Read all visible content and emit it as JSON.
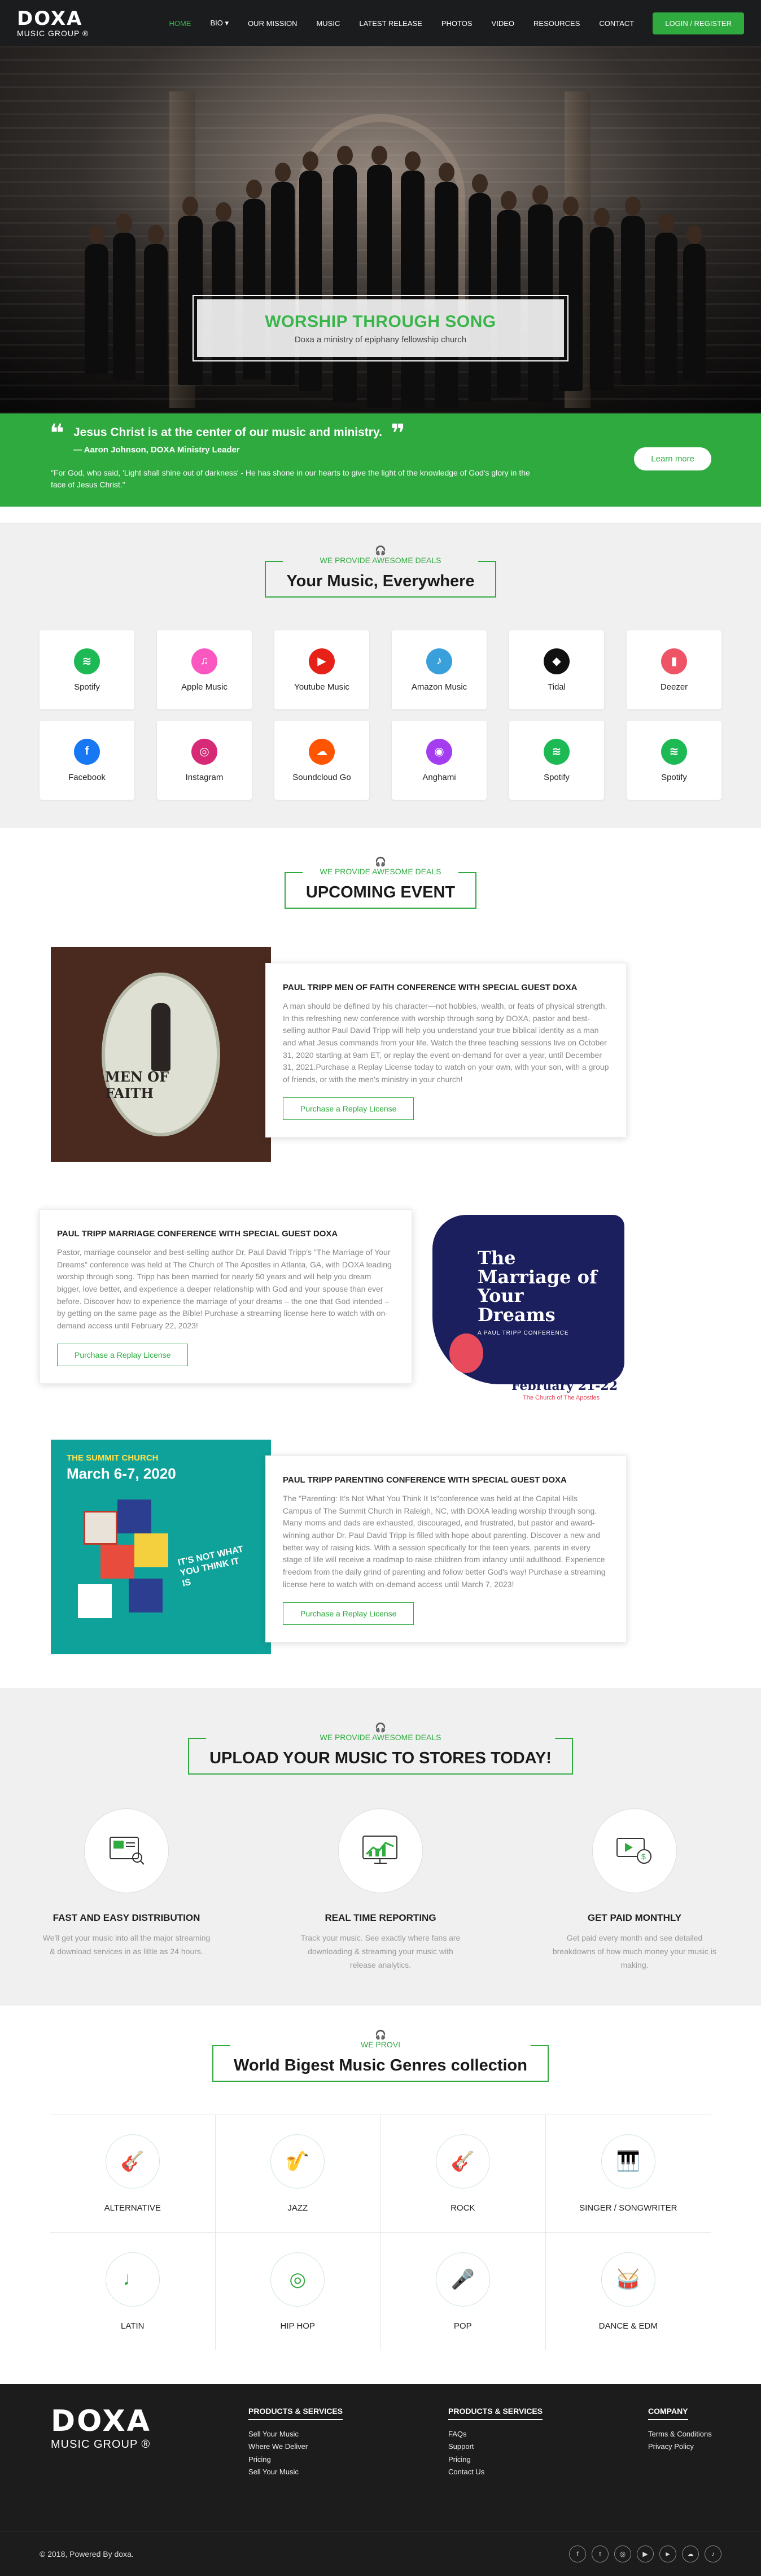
{
  "brand": {
    "logo_big": "DOXA",
    "logo_small": "MUSIC GROUP ®"
  },
  "nav": {
    "items": [
      "HOME",
      "BIO ▾",
      "OUR MISSION",
      "MUSIC",
      "LATEST RELEASE",
      "PHOTOS",
      "VIDEO",
      "RESOURCES",
      "CONTACT"
    ],
    "active_index": 0,
    "login": "LOGIN / REGISTER"
  },
  "hero": {
    "title": "WORSHIP THROUGH SONG",
    "subtitle": "Doxa a ministry of epiphany fellowship church"
  },
  "quote": {
    "main": "Jesus Christ is at the center of our music and ministry.",
    "author": "— Aaron Johnson, DOXA Ministry Leader",
    "verse": "\"For God, who said, 'Light shall shine out of darkness' - He has shone in our hearts to give the light of the knowledge of God's glory in the face of Jesus Christ.\"",
    "button": "Learn more"
  },
  "platforms_section": {
    "small": "WE PROVIDE AWESOME DEALS",
    "title": "Your Music, Everywhere",
    "items": [
      {
        "label": "Spotify",
        "icon": "spotify-icon",
        "color": "#1db954"
      },
      {
        "label": "Apple Music",
        "icon": "apple-music-icon",
        "color": "#fa57c1"
      },
      {
        "label": "Youtube Music",
        "icon": "youtube-music-icon",
        "color": "#e62117"
      },
      {
        "label": "Amazon Music",
        "icon": "amazon-music-icon",
        "color": "#3aa0dc"
      },
      {
        "label": "Tidal",
        "icon": "tidal-icon",
        "color": "#111111"
      },
      {
        "label": "Deezer",
        "icon": "deezer-icon",
        "color": "#ef5466"
      },
      {
        "label": "Facebook",
        "icon": "facebook-icon",
        "color": "#1877f2"
      },
      {
        "label": "Instagram",
        "icon": "instagram-icon",
        "color": "#d62976"
      },
      {
        "label": "Soundcloud Go",
        "icon": "soundcloud-icon",
        "color": "#ff5500"
      },
      {
        "label": "Anghami",
        "icon": "anghami-icon",
        "color": "#a43cf0"
      },
      {
        "label": "Spotify",
        "icon": "spotify-icon",
        "color": "#1db954"
      },
      {
        "label": "Spotify",
        "icon": "spotify-icon",
        "color": "#1db954"
      }
    ]
  },
  "events_section": {
    "small": "WE PROVIDE AWESOME DEALS",
    "title": "UPCOMING EVENT",
    "events": [
      {
        "title": "PAUL TRIPP MEN OF FAITH CONFERENCE WITH SPECIAL GUEST DOXA",
        "desc": "A man should be defined by his character—not hobbies, wealth, or feats of physical strength. In this refreshing new conference with worship through song by DOXA, pastor and best-selling author Paul David Tripp will help you understand your true biblical identity as a man and what Jesus commands from your life. Watch the three teaching sessions live on October 31, 2020 starting at 9am ET, or replay the event on-demand for over a year, until December 31, 2021.Purchase a Replay License today to watch on your own, with your son, with a group of friends, or with the men's ministry in your church!",
        "button": "Purchase a Replay License",
        "image_text": "MEN OF FAITH"
      },
      {
        "title": "PAUL TRIPP MARRIAGE CONFERENCE WITH SPECIAL GUEST DOXA",
        "desc": "Pastor, marriage counselor and best-selling author Dr. Paul David Tripp's \"The Marriage of Your Dreams\" conference was held at The Church of The Apostles in Atlanta, GA, with DOXA leading worship through song. Tripp has been married for nearly 50 years and will help you dream bigger, love better, and experience a deeper relationship with God and your spouse than ever before. Discover how to experience the marriage of your dreams – the one that God intended – by getting on the same page as the Bible! Purchase a streaming license here to watch with on-demand access until February 22, 2023!",
        "button": "Purchase a Replay License",
        "image_title": "The Marriage of Your Dreams",
        "image_sub": "A PAUL TRIPP CONFERENCE",
        "image_date": "February 21-22",
        "image_place": "The Church of The Apostles"
      },
      {
        "title": "PAUL TRIPP PARENTING CONFERENCE WITH SPECIAL GUEST DOXA",
        "desc": "The \"Parenting: It's Not What You Think It Is\"conference was held at the Capital Hills Campus of The Summit Church in Raleigh, NC, with DOXA leading worship through song. Many moms and dads are exhausted, discouraged, and frustrated, but pastor and award-winning author Dr. Paul David Tripp is filled with hope about parenting. Discover a new and better way of raising kids. With a session specifically for the teen years, parents in every stage of life will receive a roadmap to raise children from infancy until adulthood. Experience freedom from the daily grind of parenting and follow better God's way! Purchase a streaming license here to watch with on-demand access until March 7, 2023!",
        "button": "Purchase a Replay License",
        "image_church": "THE SUMMIT CHURCH",
        "image_date": "March 6-7, 2020",
        "image_tag": "IT'S NOT WHAT YOU THINK IT IS"
      }
    ]
  },
  "upload_section": {
    "small": "WE PROVIDE AWESOME DEALS",
    "title": "UPLOAD YOUR MUSIC TO STORES TODAY!",
    "features": [
      {
        "title": "FAST AND EASY DISTRIBUTION",
        "desc": "We'll get your music into all the major streaming & download services in as little as 24 hours.",
        "icon": "distribution-icon"
      },
      {
        "title": "REAL TIME REPORTING",
        "desc": "Track your music. See exactly where fans are downloading & streaming your music with release analytics.",
        "icon": "reporting-icon"
      },
      {
        "title": "GET PAID MONTHLY",
        "desc": "Get paid every month and see detailed breakdowns of how much money your music is making.",
        "icon": "payment-icon"
      }
    ]
  },
  "genres_section": {
    "small": "WE PROVI",
    "title": "World Bigest Music Genres collection",
    "items": [
      {
        "label": "ALTERNATIVE",
        "icon": "guitar-icon"
      },
      {
        "label": "JAZZ",
        "icon": "saxophone-icon"
      },
      {
        "label": "ROCK",
        "icon": "electric-guitar-icon"
      },
      {
        "label": "SINGER / SONGWRITER",
        "icon": "keyboard-icon"
      },
      {
        "label": "LATIN",
        "icon": "maracas-icon"
      },
      {
        "label": "HIP HOP",
        "icon": "vinyl-icon"
      },
      {
        "label": "POP",
        "icon": "microphone-icon"
      },
      {
        "label": "DANCE & EDM",
        "icon": "drums-icon"
      }
    ]
  },
  "footer": {
    "logo_big": "DOXA",
    "logo_small": "MUSIC GROUP ®",
    "cols": [
      {
        "title": "PRODUCTS & SERVICES",
        "links": [
          "Sell Your Music",
          "Where We Deliver",
          "Pricing",
          "Sell Your Music"
        ]
      },
      {
        "title": "PRODUCTS & SERVICES",
        "links": [
          "FAQs",
          "Support",
          "Pricing",
          "Contact Us"
        ]
      },
      {
        "title": "COMPANY",
        "links": [
          "Terms & Conditions",
          "Privacy Policy"
        ]
      }
    ],
    "copyright": "© 2018, Powered By doxa.",
    "socials": [
      "facebook-icon",
      "twitter-icon",
      "instagram-icon",
      "youtube-icon",
      "play-icon",
      "soundcloud-icon",
      "music-icon"
    ]
  }
}
